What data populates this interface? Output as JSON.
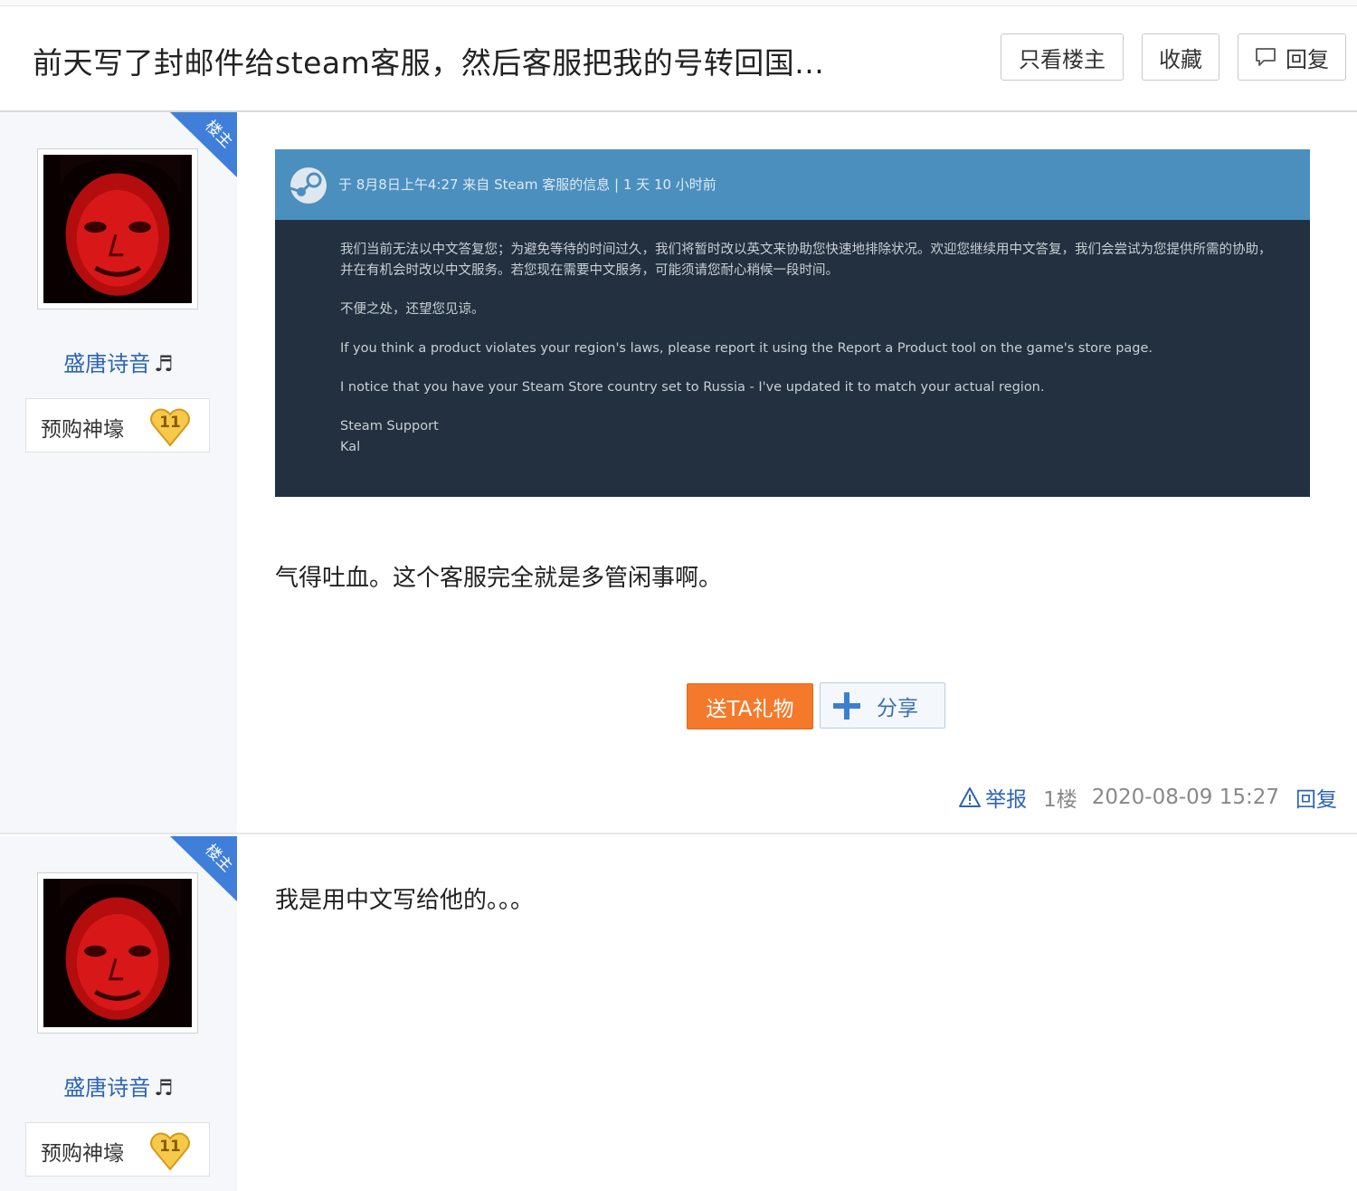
{
  "thread": {
    "title": "前天写了封邮件给steam客服，然后客服把我的号转回国...",
    "buttons": {
      "only_op": "只看楼主",
      "favorite": "收藏",
      "reply": "回复"
    }
  },
  "posts": [
    {
      "user": {
        "name": "盛唐诗音",
        "name_suffix": "♬",
        "badge_text": "预购神壕",
        "badge_level": "11",
        "role_tag": "楼主"
      },
      "screenshot": {
        "meta": "于 8月8日上午4:27 来自 Steam 客服的信息 | 1 天 10 小时前",
        "paragraphs": [
          "我们当前无法以中文答复您；为避免等待的时间过久，我们将暂时改以英文来协助您快速地排除状况。欢迎您继续用中文答复，我们会尝试为您提供所需的协助，并在有机会时改以中文服务。若您现在需要中文服务，可能须请您耐心稍候一段时间。",
          "不便之处，还望您见谅。",
          "If you think a product violates your region's laws, please report it using the Report a Product tool on the game's store page.",
          "I notice that you have your Steam Store country set to Russia - I've updated it to match your actual region.",
          "Steam Support",
          "Kal"
        ]
      },
      "content": "气得吐血。这个客服完全就是多管闲事啊。",
      "actions": {
        "gift": "送TA礼物",
        "share": "分享"
      },
      "footer": {
        "report": "举报",
        "floor": "1楼",
        "time": "2020-08-09 15:27",
        "reply": "回复"
      }
    },
    {
      "user": {
        "name": "盛唐诗音",
        "name_suffix": "♬",
        "badge_text": "预购神壕",
        "badge_level": "11",
        "role_tag": "楼主"
      },
      "content": "我是用中文写给他的。。。"
    }
  ],
  "colors": {
    "accent_blue": "#2d64b3",
    "gift_orange": "#f5792a",
    "steam_header": "#4b8fbf",
    "steam_body": "#22303f",
    "corner_tag": "#3f7fd9"
  }
}
